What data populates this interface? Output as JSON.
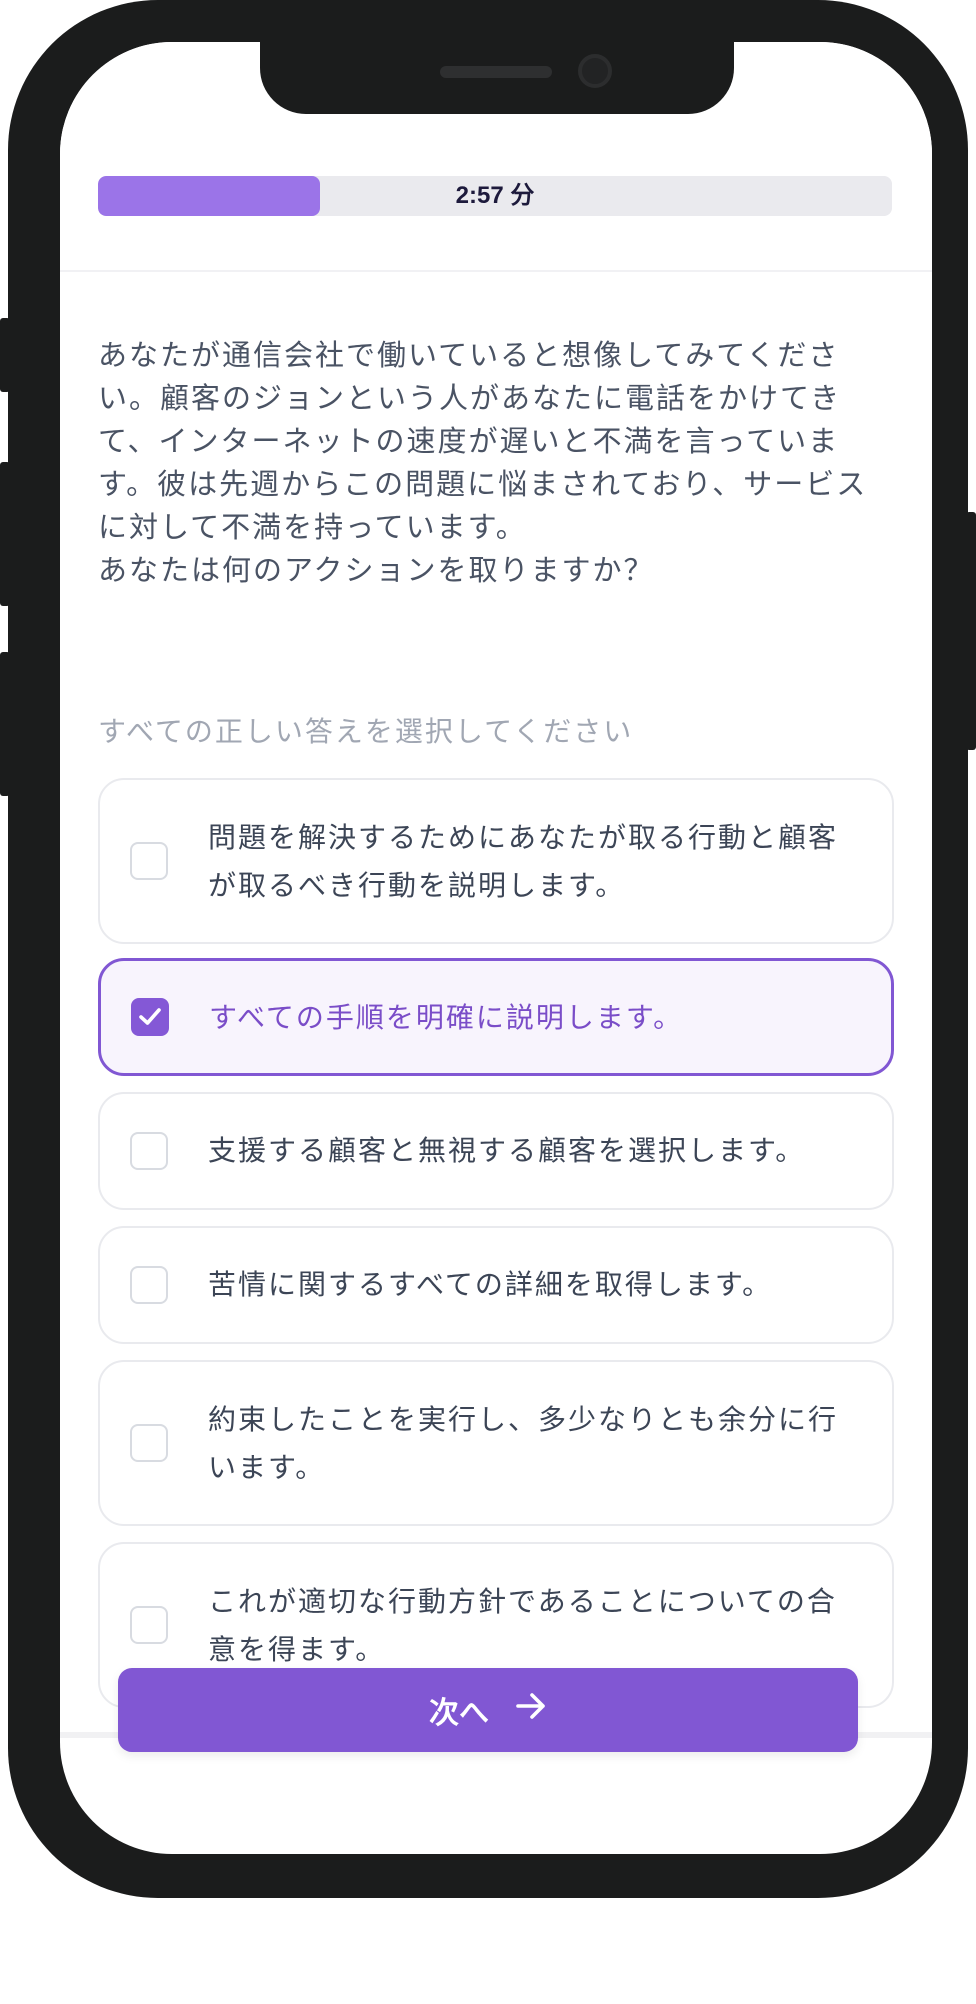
{
  "quiz": {
    "timer_label": "2:57 分",
    "progress": 0.28,
    "question": "あなたが通信会社で働いていると想像してみてください。顧客のジョンという人があなたに電話をかけてきて、インターネットの速度が遅いと不満を言っています。彼は先週からこの問題に悩まされており、サービスに対して不満を持っています。\nあなたは何のアクションを取りますか？",
    "instruction": "すべての正しい答えを選択してください",
    "options": [
      {
        "label": "問題を解決するためにあなたが取る行動と顧客が取るべき行動を説明します。",
        "selected": false
      },
      {
        "label": "すべての手順を明確に説明します。",
        "selected": true
      },
      {
        "label": "支援する顧客と無視する顧客を選択します。",
        "selected": false
      },
      {
        "label": "苦情に関するすべての詳細を取得します。",
        "selected": false
      },
      {
        "label": "約束したことを実行し、多少なりとも余分に行います。",
        "selected": false
      },
      {
        "label": "これが適切な行動方針であることについての合意を得ます。",
        "selected": false
      }
    ],
    "next_label": "次へ",
    "next_icon": "arrow-right-icon"
  },
  "colors": {
    "accent": "#8157d3",
    "progress_fill": "#9b74e8",
    "selected_bg": "#f8f4fd",
    "text": "#4a5364"
  }
}
